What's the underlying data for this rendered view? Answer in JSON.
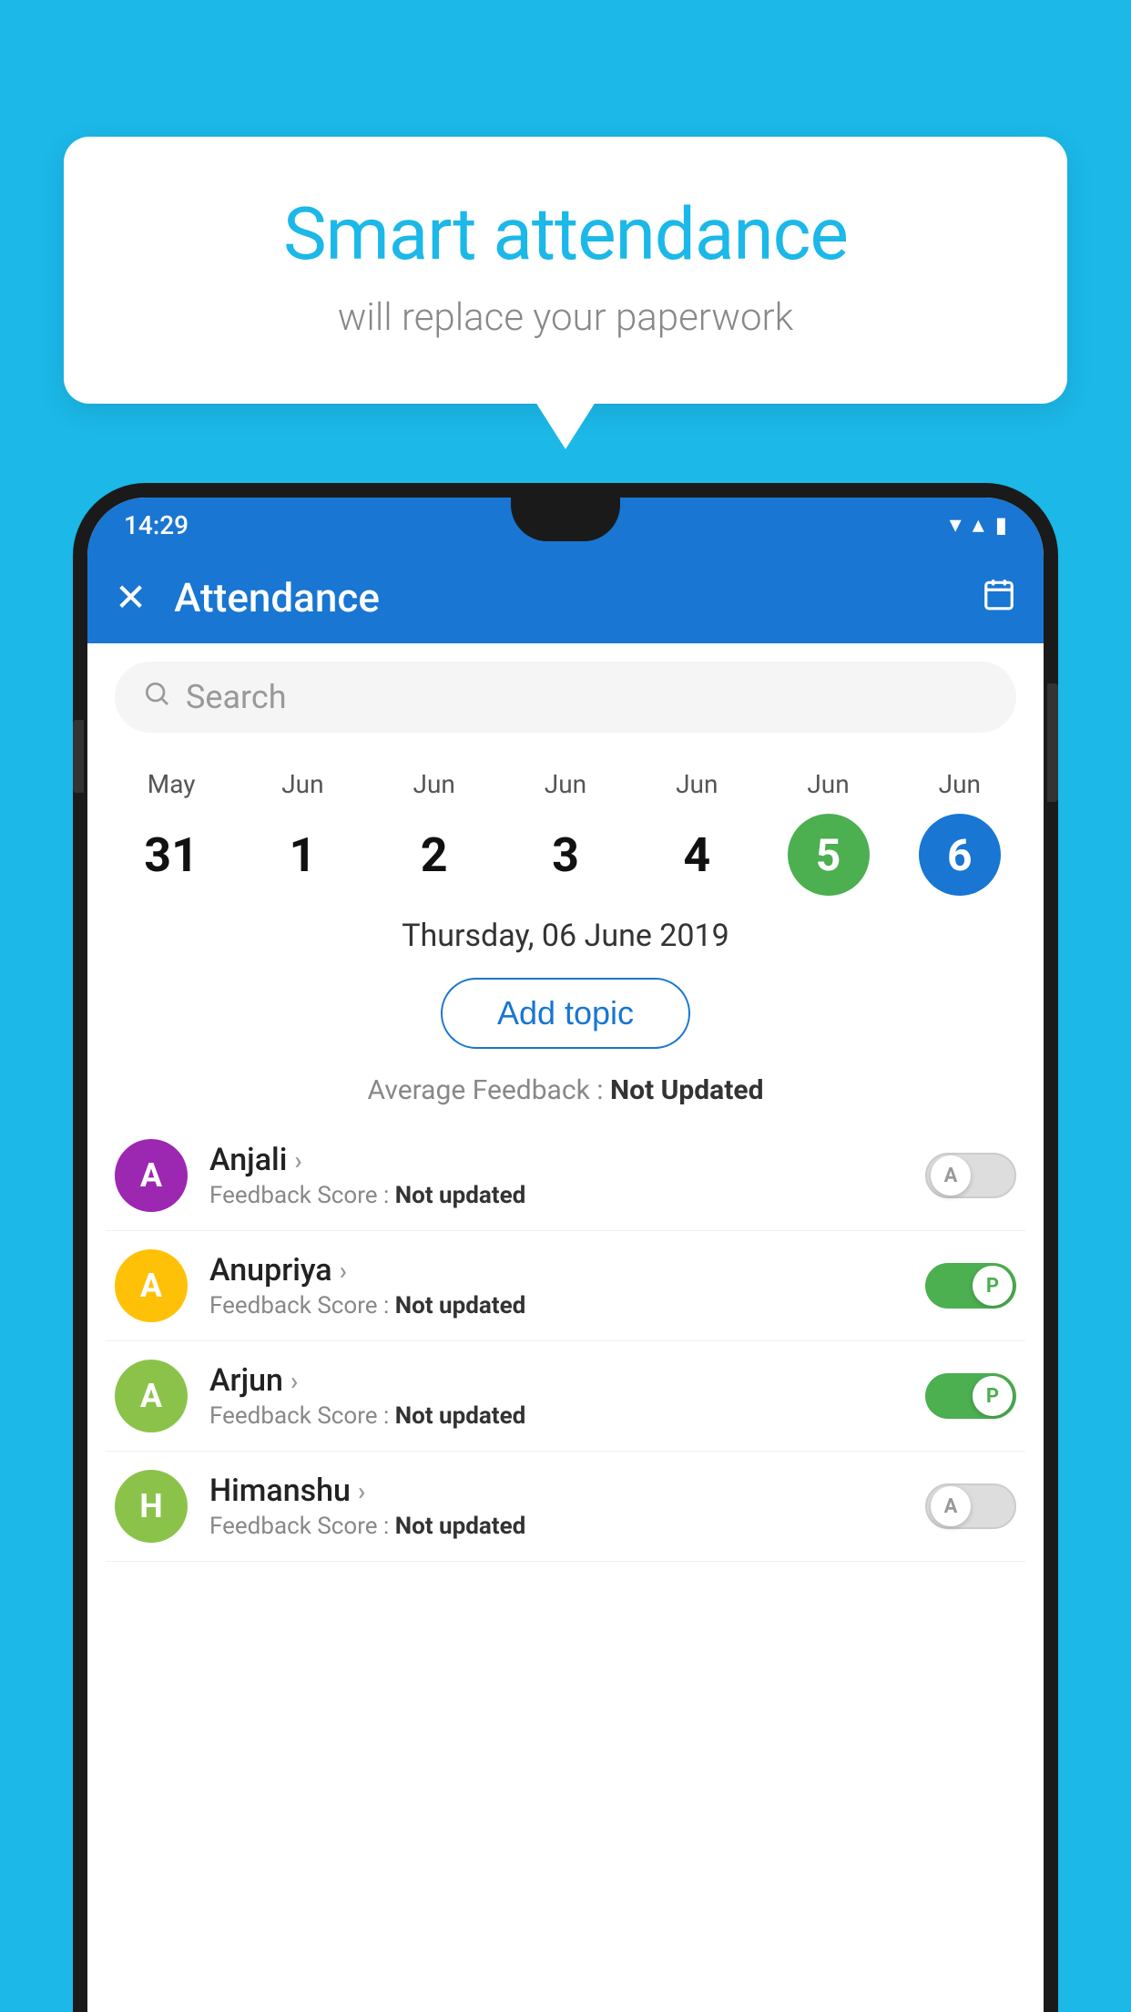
{
  "background_color": "#1BB8E8",
  "bubble": {
    "title": "Smart attendance",
    "subtitle": "will replace your paperwork"
  },
  "status_bar": {
    "time": "14:29",
    "wifi_icon": "▼",
    "signal_icon": "▲",
    "battery_icon": "▮"
  },
  "app_bar": {
    "close_label": "✕",
    "title": "Attendance",
    "calendar_icon": "📅"
  },
  "search": {
    "placeholder": "Search"
  },
  "dates": [
    {
      "month": "May",
      "num": "31",
      "style": "normal"
    },
    {
      "month": "Jun",
      "num": "1",
      "style": "normal"
    },
    {
      "month": "Jun",
      "num": "2",
      "style": "normal"
    },
    {
      "month": "Jun",
      "num": "3",
      "style": "normal"
    },
    {
      "month": "Jun",
      "num": "4",
      "style": "normal"
    },
    {
      "month": "Jun",
      "num": "5",
      "style": "today"
    },
    {
      "month": "Jun",
      "num": "6",
      "style": "selected"
    }
  ],
  "selected_date_label": "Thursday, 06 June 2019",
  "add_topic_label": "Add topic",
  "avg_feedback_label": "Average Feedback : ",
  "avg_feedback_value": "Not Updated",
  "students": [
    {
      "name": "Anjali",
      "avatar_letter": "A",
      "avatar_color": "#9C27B0",
      "feedback": "Not updated",
      "toggle": "off",
      "toggle_label": "A"
    },
    {
      "name": "Anupriya",
      "avatar_letter": "A",
      "avatar_color": "#FFC107",
      "feedback": "Not updated",
      "toggle": "on",
      "toggle_label": "P"
    },
    {
      "name": "Arjun",
      "avatar_letter": "A",
      "avatar_color": "#8BC34A",
      "feedback": "Not updated",
      "toggle": "on",
      "toggle_label": "P"
    },
    {
      "name": "Himanshu",
      "avatar_letter": "H",
      "avatar_color": "#8BC34A",
      "feedback": "Not updated",
      "toggle": "off",
      "toggle_label": "A"
    }
  ]
}
